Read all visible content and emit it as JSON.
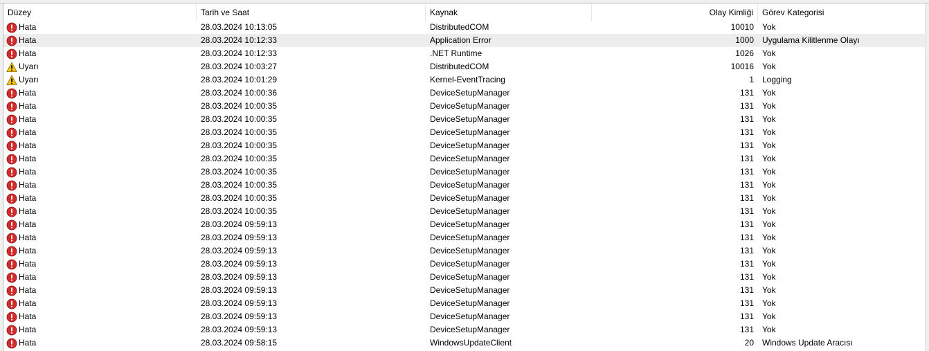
{
  "columns": {
    "level": "Düzey",
    "date": "Tarih ve Saat",
    "source": "Kaynak",
    "event_id": "Olay Kimliği",
    "category": "Görev Kategorisi"
  },
  "colors": {
    "error": "#d22b2b",
    "warning": "#f5c518",
    "selected_row": "#ededed"
  },
  "events": [
    {
      "level": "Hata",
      "icon": "error-icon",
      "date": "28.03.2024 10:13:05",
      "source": "DistributedCOM",
      "event_id": "10010",
      "category": "Yok"
    },
    {
      "level": "Hata",
      "icon": "error-icon",
      "date": "28.03.2024 10:12:33",
      "source": "Application Error",
      "event_id": "1000",
      "category": "Uygulama Kilitlenme Olayı"
    },
    {
      "level": "Hata",
      "icon": "error-icon",
      "date": "28.03.2024 10:12:33",
      "source": ".NET Runtime",
      "event_id": "1026",
      "category": "Yok"
    },
    {
      "level": "Uyarı",
      "icon": "warning-icon",
      "date": "28.03.2024 10:03:27",
      "source": "DistributedCOM",
      "event_id": "10016",
      "category": "Yok"
    },
    {
      "level": "Uyarı",
      "icon": "warning-icon",
      "date": "28.03.2024 10:01:29",
      "source": "Kernel-EventTracing",
      "event_id": "1",
      "category": "Logging"
    },
    {
      "level": "Hata",
      "icon": "error-icon",
      "date": "28.03.2024 10:00:36",
      "source": "DeviceSetupManager",
      "event_id": "131",
      "category": "Yok"
    },
    {
      "level": "Hata",
      "icon": "error-icon",
      "date": "28.03.2024 10:00:35",
      "source": "DeviceSetupManager",
      "event_id": "131",
      "category": "Yok"
    },
    {
      "level": "Hata",
      "icon": "error-icon",
      "date": "28.03.2024 10:00:35",
      "source": "DeviceSetupManager",
      "event_id": "131",
      "category": "Yok"
    },
    {
      "level": "Hata",
      "icon": "error-icon",
      "date": "28.03.2024 10:00:35",
      "source": "DeviceSetupManager",
      "event_id": "131",
      "category": "Yok"
    },
    {
      "level": "Hata",
      "icon": "error-icon",
      "date": "28.03.2024 10:00:35",
      "source": "DeviceSetupManager",
      "event_id": "131",
      "category": "Yok"
    },
    {
      "level": "Hata",
      "icon": "error-icon",
      "date": "28.03.2024 10:00:35",
      "source": "DeviceSetupManager",
      "event_id": "131",
      "category": "Yok"
    },
    {
      "level": "Hata",
      "icon": "error-icon",
      "date": "28.03.2024 10:00:35",
      "source": "DeviceSetupManager",
      "event_id": "131",
      "category": "Yok"
    },
    {
      "level": "Hata",
      "icon": "error-icon",
      "date": "28.03.2024 10:00:35",
      "source": "DeviceSetupManager",
      "event_id": "131",
      "category": "Yok"
    },
    {
      "level": "Hata",
      "icon": "error-icon",
      "date": "28.03.2024 10:00:35",
      "source": "DeviceSetupManager",
      "event_id": "131",
      "category": "Yok"
    },
    {
      "level": "Hata",
      "icon": "error-icon",
      "date": "28.03.2024 10:00:35",
      "source": "DeviceSetupManager",
      "event_id": "131",
      "category": "Yok"
    },
    {
      "level": "Hata",
      "icon": "error-icon",
      "date": "28.03.2024 09:59:13",
      "source": "DeviceSetupManager",
      "event_id": "131",
      "category": "Yok"
    },
    {
      "level": "Hata",
      "icon": "error-icon",
      "date": "28.03.2024 09:59:13",
      "source": "DeviceSetupManager",
      "event_id": "131",
      "category": "Yok"
    },
    {
      "level": "Hata",
      "icon": "error-icon",
      "date": "28.03.2024 09:59:13",
      "source": "DeviceSetupManager",
      "event_id": "131",
      "category": "Yok"
    },
    {
      "level": "Hata",
      "icon": "error-icon",
      "date": "28.03.2024 09:59:13",
      "source": "DeviceSetupManager",
      "event_id": "131",
      "category": "Yok"
    },
    {
      "level": "Hata",
      "icon": "error-icon",
      "date": "28.03.2024 09:59:13",
      "source": "DeviceSetupManager",
      "event_id": "131",
      "category": "Yok"
    },
    {
      "level": "Hata",
      "icon": "error-icon",
      "date": "28.03.2024 09:59:13",
      "source": "DeviceSetupManager",
      "event_id": "131",
      "category": "Yok"
    },
    {
      "level": "Hata",
      "icon": "error-icon",
      "date": "28.03.2024 09:59:13",
      "source": "DeviceSetupManager",
      "event_id": "131",
      "category": "Yok"
    },
    {
      "level": "Hata",
      "icon": "error-icon",
      "date": "28.03.2024 09:59:13",
      "source": "DeviceSetupManager",
      "event_id": "131",
      "category": "Yok"
    },
    {
      "level": "Hata",
      "icon": "error-icon",
      "date": "28.03.2024 09:59:13",
      "source": "DeviceSetupManager",
      "event_id": "131",
      "category": "Yok"
    },
    {
      "level": "Hata",
      "icon": "error-icon",
      "date": "28.03.2024 09:58:15",
      "source": "WindowsUpdateClient",
      "event_id": "20",
      "category": "Windows Update Aracısı"
    }
  ],
  "selected_row": 1
}
